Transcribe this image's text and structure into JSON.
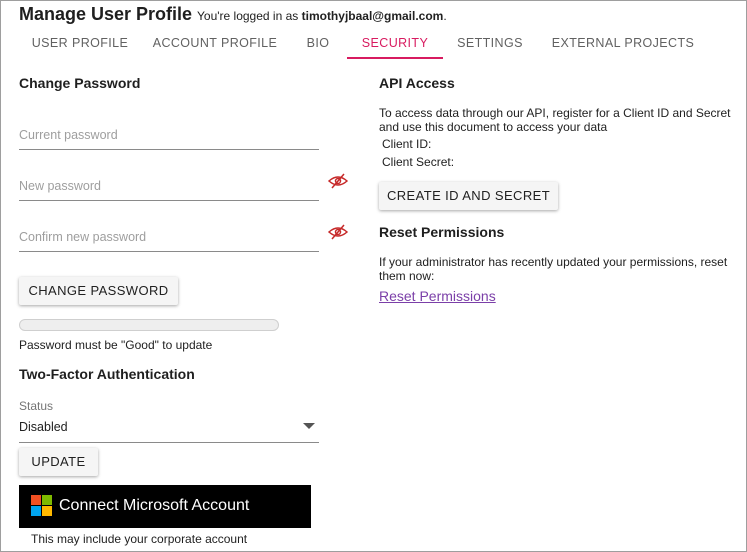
{
  "header": {
    "title": "Manage User Profile",
    "login_prefix": "You're logged in as",
    "login_email": "timothyjbaal@gmail.com",
    "login_suffix": "."
  },
  "tabs": [
    {
      "label": "USER PROFILE",
      "active": false
    },
    {
      "label": "ACCOUNT PROFILE",
      "active": false
    },
    {
      "label": "BIO",
      "active": false
    },
    {
      "label": "SECURITY",
      "active": true
    },
    {
      "label": "SETTINGS",
      "active": false
    },
    {
      "label": "EXTERNAL PROJECTS",
      "active": false
    }
  ],
  "change_password": {
    "heading": "Change Password",
    "current_placeholder": "Current password",
    "new_placeholder": "New password",
    "confirm_placeholder": "Confirm new password",
    "visibility_icon": "eye-off-icon",
    "button_label": "CHANGE PASSWORD",
    "strength_progress": 0,
    "strength_hint": "Password must be \"Good\" to update"
  },
  "two_factor": {
    "heading": "Two-Factor Authentication",
    "status_label": "Status",
    "status_value": "Disabled",
    "update_label": "UPDATE",
    "microsoft_label": "Connect Microsoft Account",
    "microsoft_note": "This may include your corporate account"
  },
  "api_access": {
    "heading": "API Access",
    "description": "To access data through our API, register for a Client ID and Secret and use this document to access your data",
    "client_id_label": "Client ID:",
    "client_secret_label": "Client Secret:",
    "create_button_label": "CREATE ID AND SECRET"
  },
  "reset_permissions": {
    "heading": "Reset Permissions",
    "description": "If your administrator has recently updated your permissions, reset them now:",
    "link_label": "Reset Permissions"
  },
  "colors": {
    "accent": "#d81b60",
    "link": "#7b3fa8",
    "eye_icon": "#c62828",
    "ms_red": "#f25022",
    "ms_green": "#7fba00",
    "ms_blue": "#00a4ef",
    "ms_yellow": "#ffb900"
  }
}
